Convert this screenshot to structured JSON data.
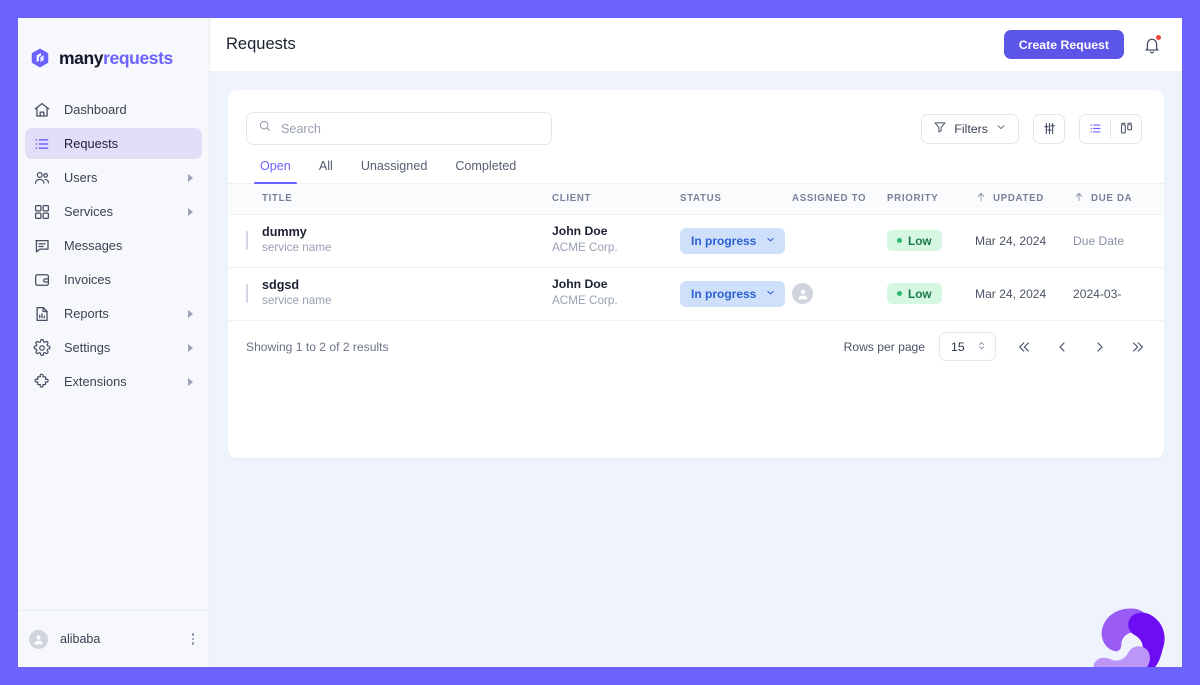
{
  "brand": {
    "name_part1": "many",
    "name_part2": "requests",
    "accent": "#6c63ff",
    "logo_icon": "manyrequests-logo-icon"
  },
  "sidebar": {
    "items": [
      {
        "label": "Dashboard",
        "icon": "home-icon",
        "active": false,
        "expandable": false
      },
      {
        "label": "Requests",
        "icon": "list-icon",
        "active": true,
        "expandable": false
      },
      {
        "label": "Users",
        "icon": "users-icon",
        "active": false,
        "expandable": true
      },
      {
        "label": "Services",
        "icon": "grid-icon",
        "active": false,
        "expandable": true
      },
      {
        "label": "Messages",
        "icon": "chat-icon",
        "active": false,
        "expandable": false
      },
      {
        "label": "Invoices",
        "icon": "wallet-icon",
        "active": false,
        "expandable": false
      },
      {
        "label": "Reports",
        "icon": "report-icon",
        "active": false,
        "expandable": true
      },
      {
        "label": "Settings",
        "icon": "gear-icon",
        "active": false,
        "expandable": true
      },
      {
        "label": "Extensions",
        "icon": "puzzle-icon",
        "active": false,
        "expandable": true
      }
    ],
    "footer": {
      "user": "alibaba",
      "avatar_icon": "user-avatar-icon",
      "menu_icon": "more-vertical-icon"
    }
  },
  "header": {
    "title": "Requests",
    "create_button": "Create Request",
    "bell_icon": "bell-icon",
    "has_notification": true
  },
  "toolbar": {
    "search_placeholder": "Search",
    "search_value": "",
    "search_icon": "search-icon",
    "filters_label": "Filters",
    "filters_icon": "funnel-icon",
    "chevron_icon": "chevron-down-icon",
    "sliders_icon": "sliders-icon",
    "list_view_icon": "list-view-icon",
    "board_view_icon": "board-view-icon",
    "active_view": "list"
  },
  "tabs": [
    {
      "label": "Open",
      "active": true
    },
    {
      "label": "All",
      "active": false
    },
    {
      "label": "Unassigned",
      "active": false
    },
    {
      "label": "Completed",
      "active": false
    }
  ],
  "table": {
    "columns": [
      {
        "key": "title",
        "label": "TITLE",
        "sorted": false
      },
      {
        "key": "client",
        "label": "CLIENT",
        "sorted": false
      },
      {
        "key": "status",
        "label": "STATUS",
        "sorted": false
      },
      {
        "key": "assigned",
        "label": "ASSIGNED TO",
        "sorted": false
      },
      {
        "key": "priority",
        "label": "PRIORITY",
        "sorted": false
      },
      {
        "key": "updated",
        "label": "UPDATED",
        "sorted": true
      },
      {
        "key": "due",
        "label": "DUE DA",
        "sorted": true
      }
    ],
    "rows": [
      {
        "title": "dummy",
        "service": "service name",
        "client_name": "John Doe",
        "client_company": "ACME Corp.",
        "status": "In progress",
        "assigned_to": "",
        "has_assignee": false,
        "priority": "Low",
        "updated": "Mar 24, 2024",
        "due": "Due Date",
        "due_is_placeholder": true
      },
      {
        "title": "sdgsd",
        "service": "service name",
        "client_name": "John Doe",
        "client_company": "ACME Corp.",
        "status": "In progress",
        "assigned_to": "",
        "has_assignee": true,
        "priority": "Low",
        "updated": "Mar 24, 2024",
        "due": "2024-03-",
        "due_is_placeholder": false
      }
    ]
  },
  "footer": {
    "showing": "Showing 1 to 2 of 2 results",
    "rows_per_page_label": "Rows per page",
    "rows_per_page_value": "15",
    "first_icon": "chevrons-left-icon",
    "prev_icon": "chevron-left-icon",
    "next_icon": "chevron-right-icon",
    "last_icon": "chevrons-right-icon"
  },
  "colors": {
    "frame_border": "#6c63ff",
    "page_background": "#eff4fc",
    "accent": "#6c63ff",
    "primary_button": "#5b55e8",
    "status_badge_bg": "#cfe0fb",
    "status_badge_fg": "#2e5fd0",
    "priority_badge_bg": "#d6f7e2",
    "priority_badge_fg": "#1d7a47",
    "notification_dot": "#f0453a"
  }
}
